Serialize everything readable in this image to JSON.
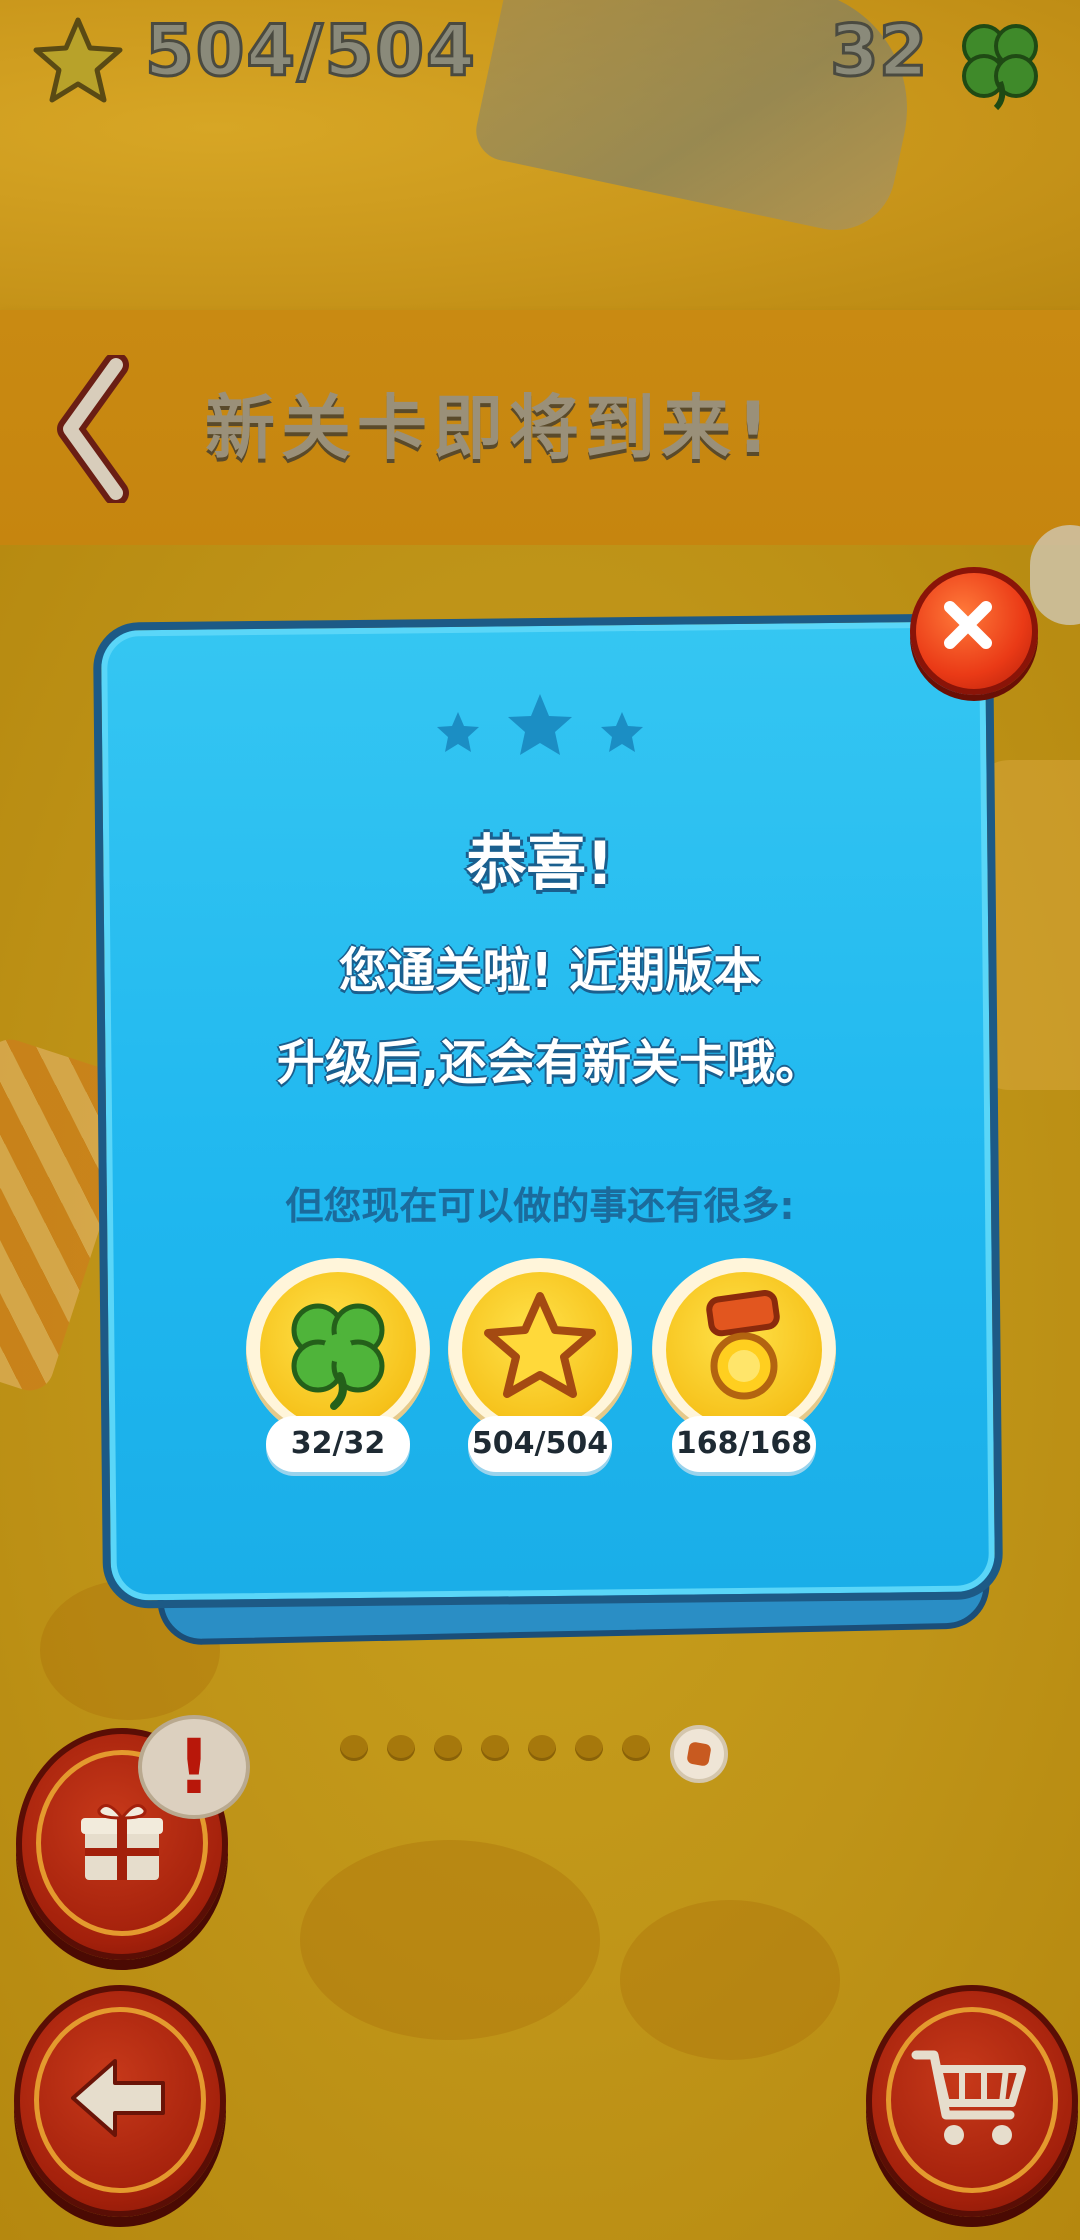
{
  "hud": {
    "stars_value": "504/504",
    "clovers_value": "32",
    "star_icon": "star-icon",
    "clover_icon": "clover-icon"
  },
  "banner": {
    "title": "新关卡即将到来!",
    "back_icon": "chevron-left-icon"
  },
  "dialog": {
    "stars_earned": 3,
    "stars_max": 3,
    "title": "恭喜!",
    "message_line1": "您通关啦! 近期版本",
    "message_line2": "升级后,还会有新关卡哦。",
    "subtitle": "但您现在可以做的事还有很多:",
    "achievements": [
      {
        "icon": "clover-icon",
        "value": "32/32"
      },
      {
        "icon": "star-icon",
        "value": "504/504"
      },
      {
        "icon": "medal-icon",
        "value": "168/168"
      }
    ],
    "close_icon": "close-icon"
  },
  "pager": {
    "total": 8,
    "active_index": 7
  },
  "buttons": {
    "gift_icon": "gift-icon",
    "gift_alert": "!",
    "back_icon": "arrow-left-icon",
    "cart_icon": "cart-icon"
  },
  "colors": {
    "dialog_blue": "#1fb7ef",
    "dialog_border": "#1d5a86",
    "close_red": "#ea3a16",
    "button_red": "#a3200b",
    "gold": "#f6c21b"
  }
}
